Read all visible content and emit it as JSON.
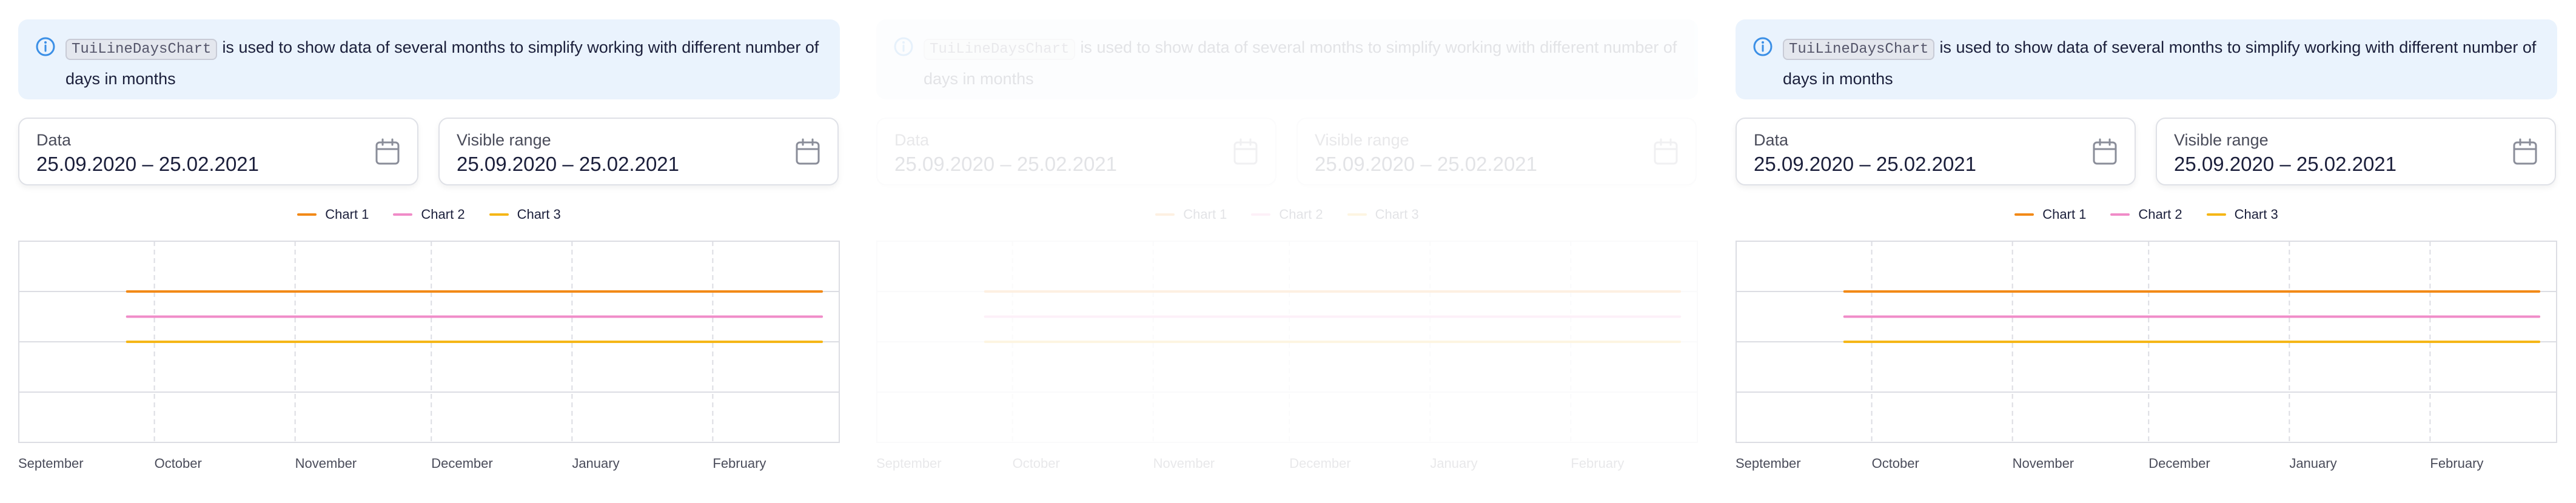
{
  "notice": {
    "code": "TuiLineDaysChart",
    "text": "is used to show data of several months to simplify working with different number of days in months"
  },
  "fields": {
    "data": {
      "label": "Data",
      "value": "25.09.2020 – 25.02.2021"
    },
    "visible_range": {
      "label": "Visible range",
      "value": "25.09.2020 – 25.02.2021"
    }
  },
  "legend": [
    {
      "name": "Chart 1",
      "color": "#f28a18"
    },
    {
      "name": "Chart 2",
      "color": "#f08cc8"
    },
    {
      "name": "Chart 3",
      "color": "#f5b617"
    }
  ],
  "chart_data": {
    "type": "line",
    "x_ticks": [
      "September",
      "October",
      "November",
      "December",
      "January",
      "February"
    ],
    "x_range": [
      "2020-09-01",
      "2021-02-28"
    ],
    "series": [
      {
        "name": "Chart 1",
        "x": [
          "2020-09-25",
          "2021-02-25"
        ],
        "y": [
          3,
          3
        ]
      },
      {
        "name": "Chart 2",
        "x": [
          "2020-09-25",
          "2021-02-25"
        ],
        "y": [
          2.5,
          2.5
        ]
      },
      {
        "name": "Chart 3",
        "x": [
          "2020-09-25",
          "2021-02-25"
        ],
        "y": [
          2,
          2
        ]
      }
    ],
    "ylim": [
      0,
      4
    ],
    "grid": true
  }
}
